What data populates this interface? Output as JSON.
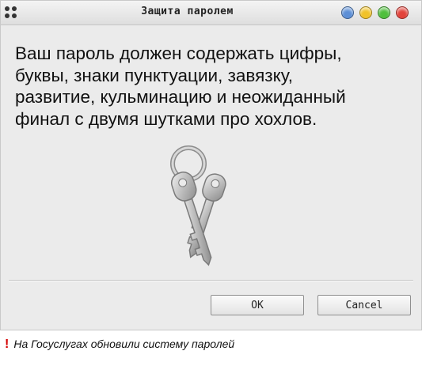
{
  "window": {
    "title": "Защита паролем",
    "controls": [
      {
        "name": "blue",
        "color": "#5d8fd6"
      },
      {
        "name": "yellow",
        "color": "#f0c22a"
      },
      {
        "name": "green",
        "color": "#4fbf3c"
      },
      {
        "name": "red",
        "color": "#e2433b"
      }
    ]
  },
  "message": "Ваш пароль должен содержать цифры,\nбуквы, знаки пунктуации, завязку,\nразвитие, кульминацию и неожиданный\nфинал с двумя шутками про хохлов.",
  "buttons": {
    "ok_label": "OK",
    "cancel_label": "Cancel"
  },
  "caption": {
    "mark": "!",
    "text": "На Госуслугах обновили систему паролей"
  }
}
